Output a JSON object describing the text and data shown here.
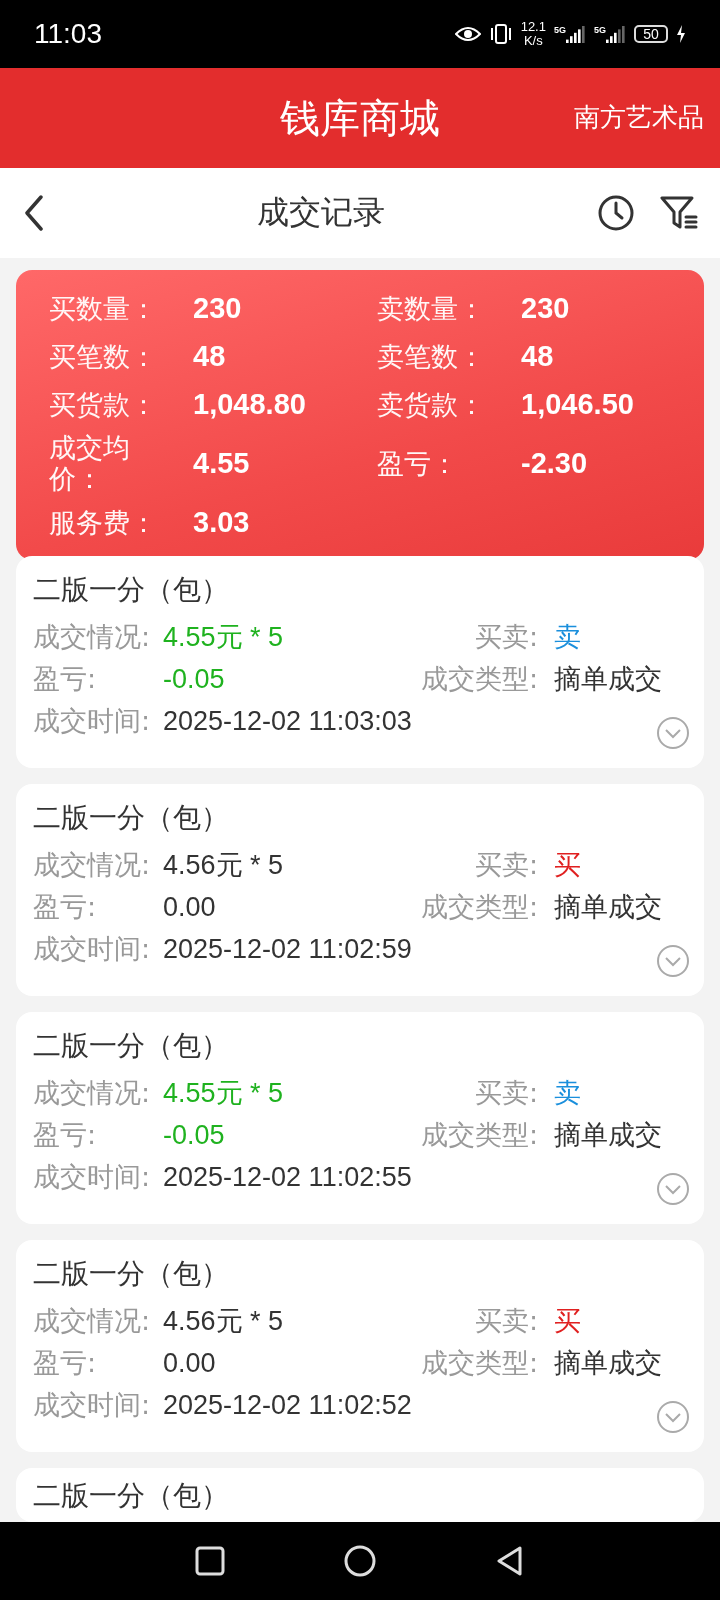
{
  "status_bar": {
    "time": "11:03",
    "speed_value": "12.1",
    "speed_unit": "K/s",
    "network_1": "5G",
    "network_2": "5G",
    "battery": "50"
  },
  "header": {
    "title": "钱库商城",
    "right_label": "南方艺术品"
  },
  "subheader": {
    "title": "成交记录"
  },
  "summary": [
    {
      "label": "买数量：",
      "value": "230"
    },
    {
      "label": "卖数量：",
      "value": "230"
    },
    {
      "label": "买笔数：",
      "value": "48"
    },
    {
      "label": "卖笔数：",
      "value": "48"
    },
    {
      "label": "买货款：",
      "value": "1,048.80"
    },
    {
      "label": "卖货款：",
      "value": "1,046.50"
    },
    {
      "label": "成交均价：",
      "value": "4.55"
    },
    {
      "label": "盈亏：",
      "value": "-2.30"
    },
    {
      "label": "服务费：",
      "value": "3.03"
    }
  ],
  "records": [
    {
      "title": "二版一分（包）",
      "kind": "sell",
      "deal_label": "成交情况:",
      "deal": "4.55元 * 5",
      "side_label": "买卖:",
      "side": "卖",
      "pnl_label": "盈亏:",
      "pnl": "-0.05",
      "type_label": "成交类型:",
      "type": "摘单成交",
      "time_label": "成交时间:",
      "time": "2025-12-02 11:03:03"
    },
    {
      "title": "二版一分（包）",
      "kind": "buy",
      "deal_label": "成交情况:",
      "deal": "4.56元 * 5",
      "side_label": "买卖:",
      "side": "买",
      "pnl_label": "盈亏:",
      "pnl": "0.00",
      "type_label": "成交类型:",
      "type": "摘单成交",
      "time_label": "成交时间:",
      "time": "2025-12-02 11:02:59"
    },
    {
      "title": "二版一分（包）",
      "kind": "sell",
      "deal_label": "成交情况:",
      "deal": "4.55元 * 5",
      "side_label": "买卖:",
      "side": "卖",
      "pnl_label": "盈亏:",
      "pnl": "-0.05",
      "type_label": "成交类型:",
      "type": "摘单成交",
      "time_label": "成交时间:",
      "time": "2025-12-02 11:02:55"
    },
    {
      "title": "二版一分（包）",
      "kind": "buy",
      "deal_label": "成交情况:",
      "deal": "4.56元 * 5",
      "side_label": "买卖:",
      "side": "买",
      "pnl_label": "盈亏:",
      "pnl": "0.00",
      "type_label": "成交类型:",
      "type": "摘单成交",
      "time_label": "成交时间:",
      "time": "2025-12-02 11:02:52"
    },
    {
      "title": "二版一分（包）",
      "kind": "partial"
    }
  ]
}
